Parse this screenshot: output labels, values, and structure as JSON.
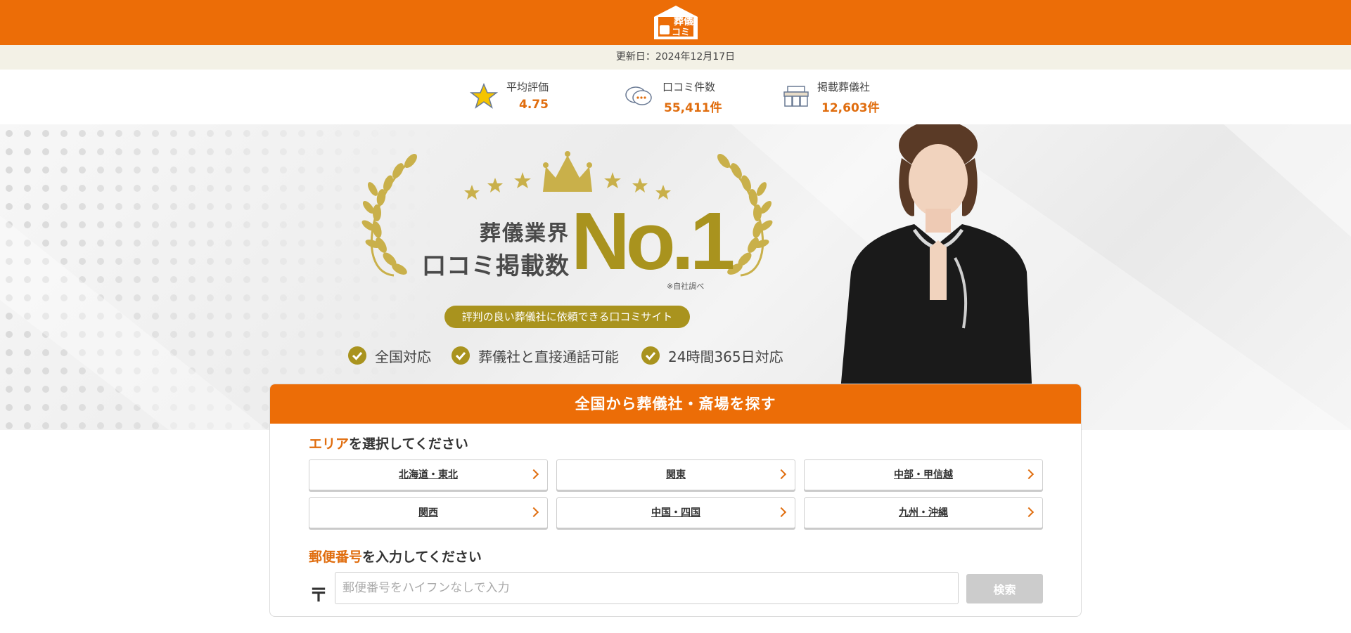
{
  "header": {
    "logo_text": "葬儀の口コミ",
    "brand_color": "#ec6d07"
  },
  "updated": {
    "text": "更新日：2024年12月17日"
  },
  "stats": [
    {
      "icon": "star-icon",
      "label": "平均評価",
      "value": "4.75"
    },
    {
      "icon": "chat-bubbles-icon",
      "label": "口コミ件数",
      "value": "55,411件"
    },
    {
      "icon": "funeral-hall-icon",
      "label": "掲載葬儀社",
      "value": "12,603件"
    }
  ],
  "hero": {
    "headline_line1": "葬儀業界",
    "headline_line2": "口コミ掲載数",
    "rank": "No.1",
    "note": "※自社調べ",
    "tagline": "評判の良い葬儀社に依頼できる口コミサイト",
    "features": [
      "全国対応",
      "葬儀社と直接通話可能",
      "24時間365日対応"
    ],
    "accent_color": "#a9931e"
  },
  "search": {
    "title": "全国から葬儀社・斎場を探す",
    "area_title_highlight": "エリア",
    "area_title_rest": "を選択してください",
    "regions": [
      "北海道・東北",
      "関東",
      "中部・甲信越",
      "関西",
      "中国・四国",
      "九州・沖縄"
    ],
    "postal_title_highlight": "郵便番号",
    "postal_title_rest": "を入力してください",
    "postal_mark": "〒",
    "postal_placeholder": "郵便番号をハイフンなしで入力",
    "postal_value": "",
    "search_button": "検索"
  }
}
